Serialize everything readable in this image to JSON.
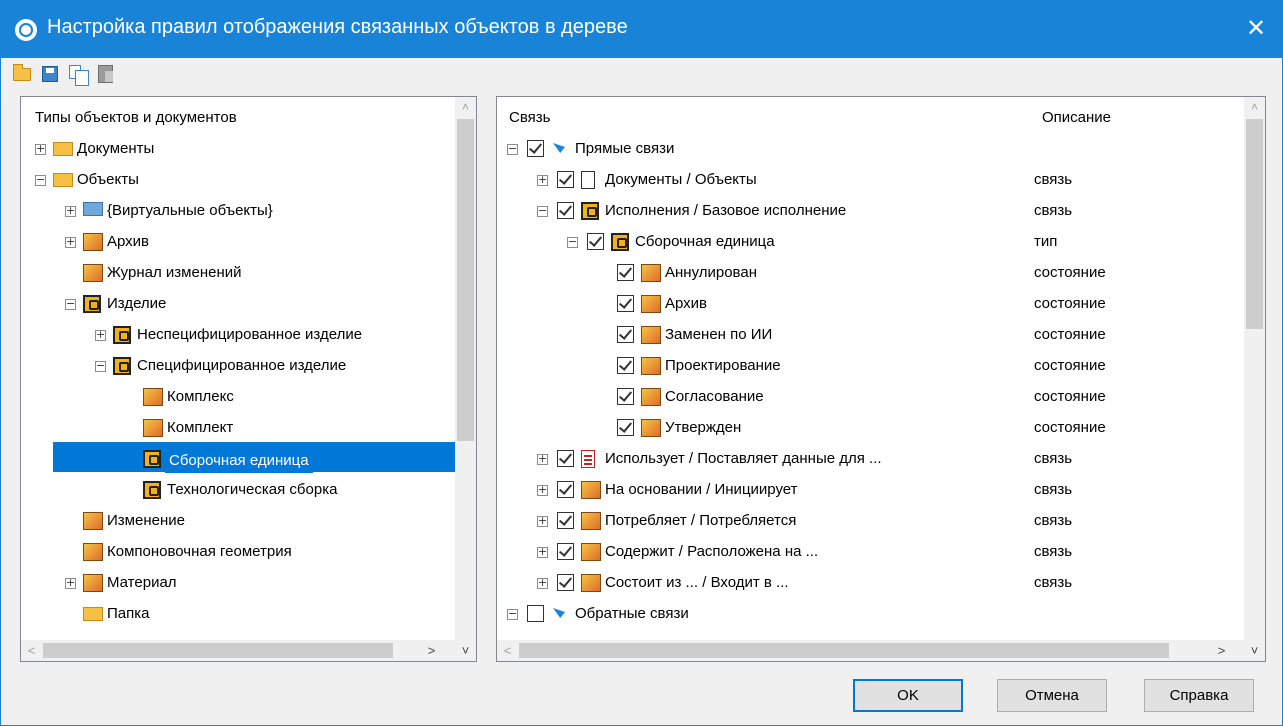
{
  "window": {
    "title": "Настройка правил отображения связанных объектов в дереве",
    "close_label": "✕"
  },
  "toolbar": {
    "buttons": [
      {
        "icon": "folder-open-icon"
      },
      {
        "icon": "save-icon"
      },
      {
        "icon": "copy-icon"
      },
      {
        "icon": "paste-icon"
      }
    ]
  },
  "left_panel": {
    "header": "Типы объектов и документов",
    "items": [
      {
        "label": "Документы",
        "icon": "folder-icon",
        "expander": "+",
        "level": 0
      },
      {
        "label": "Объекты",
        "icon": "folder-open-icon",
        "expander": "−",
        "level": 0
      },
      {
        "label": "{Виртуальные объекты}",
        "icon": "folder-blue-icon",
        "expander": "+",
        "level": 1
      },
      {
        "label": "Архив",
        "icon": "archive-icon",
        "expander": "+",
        "level": 1
      },
      {
        "label": "Журнал изменений",
        "icon": "change-log-icon",
        "expander": "",
        "level": 1
      },
      {
        "label": "Изделие",
        "icon": "product-icon",
        "expander": "−",
        "level": 1
      },
      {
        "label": "Неспецифицированное изделие",
        "icon": "unspecified-product-icon",
        "expander": "+",
        "level": 2
      },
      {
        "label": "Специфицированное изделие",
        "icon": "specified-product-icon",
        "expander": "−",
        "level": 2
      },
      {
        "label": "Комплекс",
        "icon": "complex-icon",
        "expander": "",
        "level": 3
      },
      {
        "label": "Комплект",
        "icon": "kit-icon",
        "expander": "",
        "level": 3
      },
      {
        "label": "Сборочная единица",
        "icon": "assembly-unit-icon",
        "expander": "",
        "level": 3,
        "selected": true
      },
      {
        "label": "Технологическая сборка",
        "icon": "tech-assembly-icon",
        "expander": "",
        "level": 3
      },
      {
        "label": "Изменение",
        "icon": "change-icon",
        "expander": "",
        "level": 1
      },
      {
        "label": "Компоновочная геометрия",
        "icon": "geometry-icon",
        "expander": "",
        "level": 1
      },
      {
        "label": "Материал",
        "icon": "material-icon",
        "expander": "+",
        "level": 1
      },
      {
        "label": "Папка",
        "icon": "folder-icon",
        "expander": "",
        "level": 1
      }
    ]
  },
  "right_panel": {
    "headers": {
      "link": "Связь",
      "description": "Описание"
    },
    "rows": [
      {
        "label": "Прямые связи",
        "desc": "",
        "expander": "−",
        "checked": true,
        "icon": "direct-links-icon",
        "level": 0
      },
      {
        "label": "Документы / Объекты",
        "desc": "связь",
        "expander": "+",
        "checked": true,
        "icon": "document-icon",
        "level": 1
      },
      {
        "label": "Исполнения / Базовое исполнение",
        "desc": "связь",
        "expander": "−",
        "checked": true,
        "icon": "product-icon",
        "level": 1
      },
      {
        "label": "Сборочная единица",
        "desc": "тип",
        "expander": "−",
        "checked": true,
        "icon": "assembly-unit-icon",
        "level": 2
      },
      {
        "label": "Аннулирован",
        "desc": "состояние",
        "expander": "",
        "checked": true,
        "icon": "annulled-icon",
        "level": 3
      },
      {
        "label": "Архив",
        "desc": "состояние",
        "expander": "",
        "checked": true,
        "icon": "archive-state-icon",
        "level": 3
      },
      {
        "label": "Заменен по ИИ",
        "desc": "состояние",
        "expander": "",
        "checked": true,
        "icon": "replaced-icon",
        "level": 3
      },
      {
        "label": "Проектирование",
        "desc": "состояние",
        "expander": "",
        "checked": true,
        "icon": "design-pencil-icon",
        "level": 3
      },
      {
        "label": "Согласование",
        "desc": "состояние",
        "expander": "",
        "checked": true,
        "icon": "approval-pencil-icon",
        "level": 3
      },
      {
        "label": "Утвержден",
        "desc": "состояние",
        "expander": "",
        "checked": true,
        "icon": "stamp-icon",
        "level": 3
      },
      {
        "label": "Использует / Поставляет данные для ...",
        "desc": "связь",
        "expander": "+",
        "checked": true,
        "icon": "document-red-icon",
        "level": 1
      },
      {
        "label": "На основании / Инициирует",
        "desc": "связь",
        "expander": "+",
        "checked": true,
        "icon": "basis-icon",
        "level": 1
      },
      {
        "label": "Потребляет / Потребляется",
        "desc": "связь",
        "expander": "+",
        "checked": true,
        "icon": "consume-icon",
        "level": 1
      },
      {
        "label": "Содержит / Расположена на ...",
        "desc": "связь",
        "expander": "+",
        "checked": true,
        "icon": "contains-icon",
        "level": 1
      },
      {
        "label": "Состоит из ... / Входит в ...",
        "desc": "связь",
        "expander": "+",
        "checked": true,
        "icon": "tree-structure-icon",
        "level": 1
      },
      {
        "label": "Обратные связи",
        "desc": "",
        "expander": "−",
        "checked": false,
        "icon": "reverse-links-icon",
        "level": 0
      }
    ]
  },
  "buttons": {
    "ok": "OK",
    "cancel": "Отмена",
    "help": "Справка"
  },
  "colors": {
    "titlebar": "#1883d7",
    "selection": "#0078d7"
  }
}
